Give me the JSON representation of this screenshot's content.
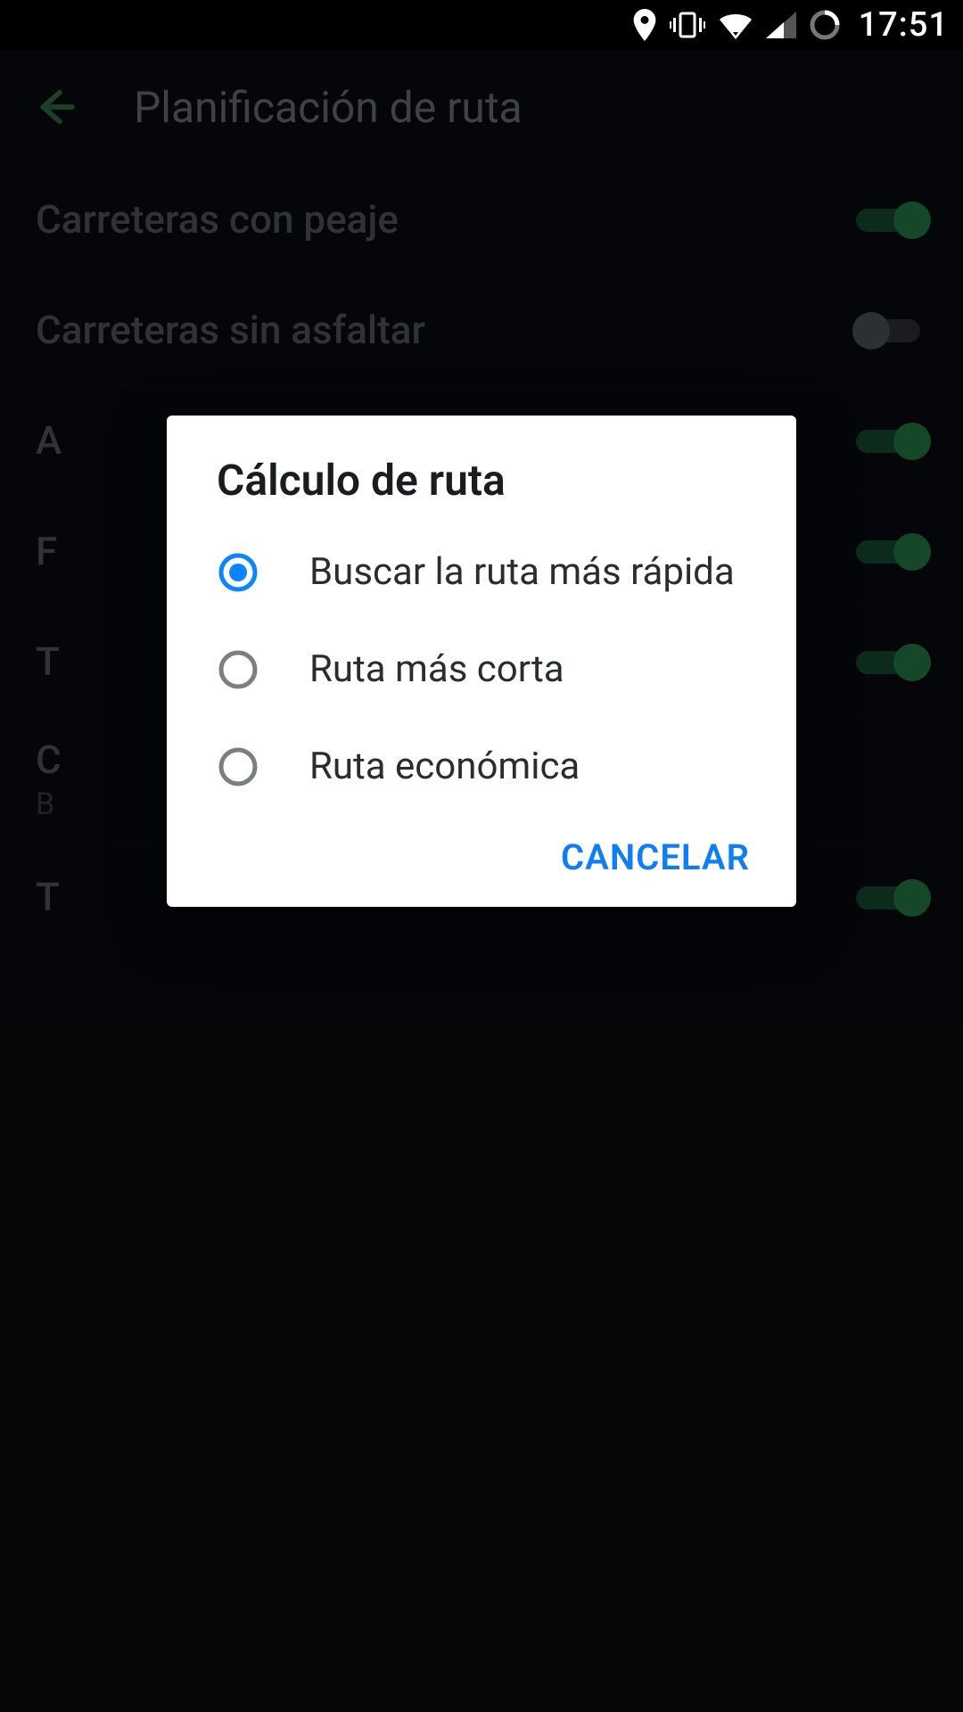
{
  "status": {
    "time": "17:51"
  },
  "header": {
    "title": "Planificación de ruta"
  },
  "settings": [
    {
      "label": "Carreteras con peaje",
      "toggle": true
    },
    {
      "label": "Carreteras sin asfaltar",
      "toggle": false
    },
    {
      "label": "A",
      "toggle": true
    },
    {
      "label": "F",
      "toggle": true
    },
    {
      "label": "T",
      "toggle": true
    },
    {
      "label": "C",
      "sub": "B"
    },
    {
      "label": "T",
      "toggle": true
    }
  ],
  "dialog": {
    "title": "Cálculo de ruta",
    "options": [
      {
        "label": "Buscar la ruta más rápida",
        "selected": true
      },
      {
        "label": "Ruta más corta",
        "selected": false
      },
      {
        "label": "Ruta económica",
        "selected": false
      }
    ],
    "cancel": "CANCELAR"
  }
}
